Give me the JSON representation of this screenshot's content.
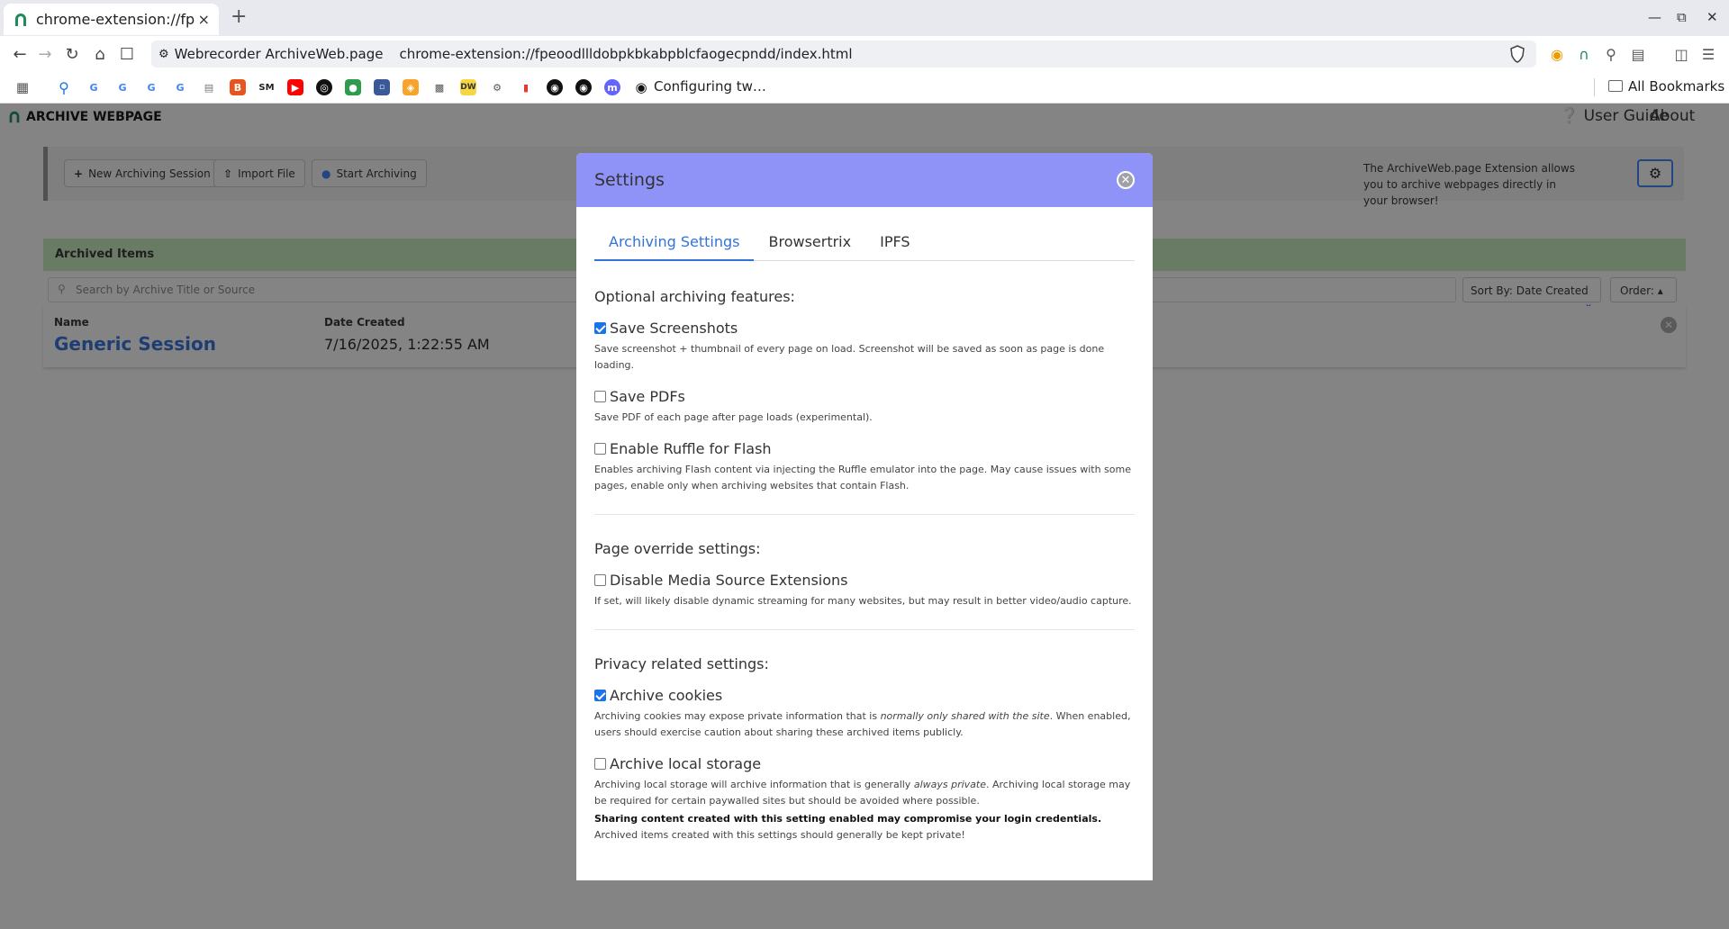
{
  "browser": {
    "tab_title": "chrome-extension://fpeoodllldobpkbkabpblcfaogecpndd",
    "tab_close": "×",
    "new_tab": "+",
    "site_name": "Webrecorder ArchiveWeb.page",
    "url": "chrome-extension://fpeoodllldobpkbkabpblcfaogecpndd/index.html",
    "bookmark_text": "Configuring tw…",
    "all_bookmarks": "All Bookmarks"
  },
  "app": {
    "logo_text": "ARCHIVE WEBPAGE",
    "user_guide": "User Guide",
    "about": "About",
    "btn_new_session": "New Archiving Session",
    "btn_import": "Import File",
    "btn_start": "Start Archiving",
    "panel_note": "The ArchiveWeb.page Extension allows you to archive webpages directly in your browser!",
    "archived_title": "Archived Items",
    "search_placeholder": "Search by Archive Title or Source",
    "sort_label": "Sort By: Date Created",
    "order_label": "Order:",
    "col_name": "Name",
    "col_date": "Date Created",
    "row": {
      "name": "Generic Session",
      "date": "7/16/2025, 1:22:55 AM"
    }
  },
  "modal": {
    "title": "Settings",
    "tabs": [
      "Archiving Settings",
      "Browsertrix",
      "IPFS"
    ],
    "sec_optional": "Optional archiving features:",
    "opt_screenshots": {
      "label": "Save Screenshots",
      "checked": true,
      "desc": "Save screenshot + thumbnail of every page on load. Screenshot will be saved as soon as page is done loading."
    },
    "opt_pdfs": {
      "label": "Save PDFs",
      "checked": false,
      "desc": "Save PDF of each page after page loads (experimental)."
    },
    "opt_ruffle": {
      "label": "Enable Ruffle for Flash",
      "checked": false,
      "desc": "Enables archiving Flash content via injecting the Ruffle emulator into the page. May cause issues with some pages, enable only when archiving websites that contain Flash."
    },
    "sec_override": "Page override settings:",
    "opt_mse": {
      "label": "Disable Media Source Extensions",
      "checked": false,
      "desc": "If set, will likely disable dynamic streaming for many websites, but may result in better video/audio capture."
    },
    "sec_privacy": "Privacy related settings:",
    "opt_cookies": {
      "label": "Archive cookies",
      "checked": true,
      "desc_a": "Archiving cookies may expose private information that is ",
      "desc_em": "normally only shared with the site",
      "desc_b": ". When enabled, users should exercise caution about sharing these archived items publicly."
    },
    "opt_storage": {
      "label": "Archive local storage",
      "checked": false,
      "desc_a": "Archiving local storage will archive information that is generally ",
      "desc_em": "always private",
      "desc_b": ". Archiving local storage may be required for certain paywalled sites but should be avoided where possible.",
      "warning": "Sharing content created with this setting enabled may compromise your login credentials.",
      "desc_c": "Archived items created with this settings should generally be kept private!"
    }
  },
  "colors": {
    "modal_header": "#8f93f8",
    "link": "#3273dc",
    "archived_header": "#c9eac0"
  }
}
